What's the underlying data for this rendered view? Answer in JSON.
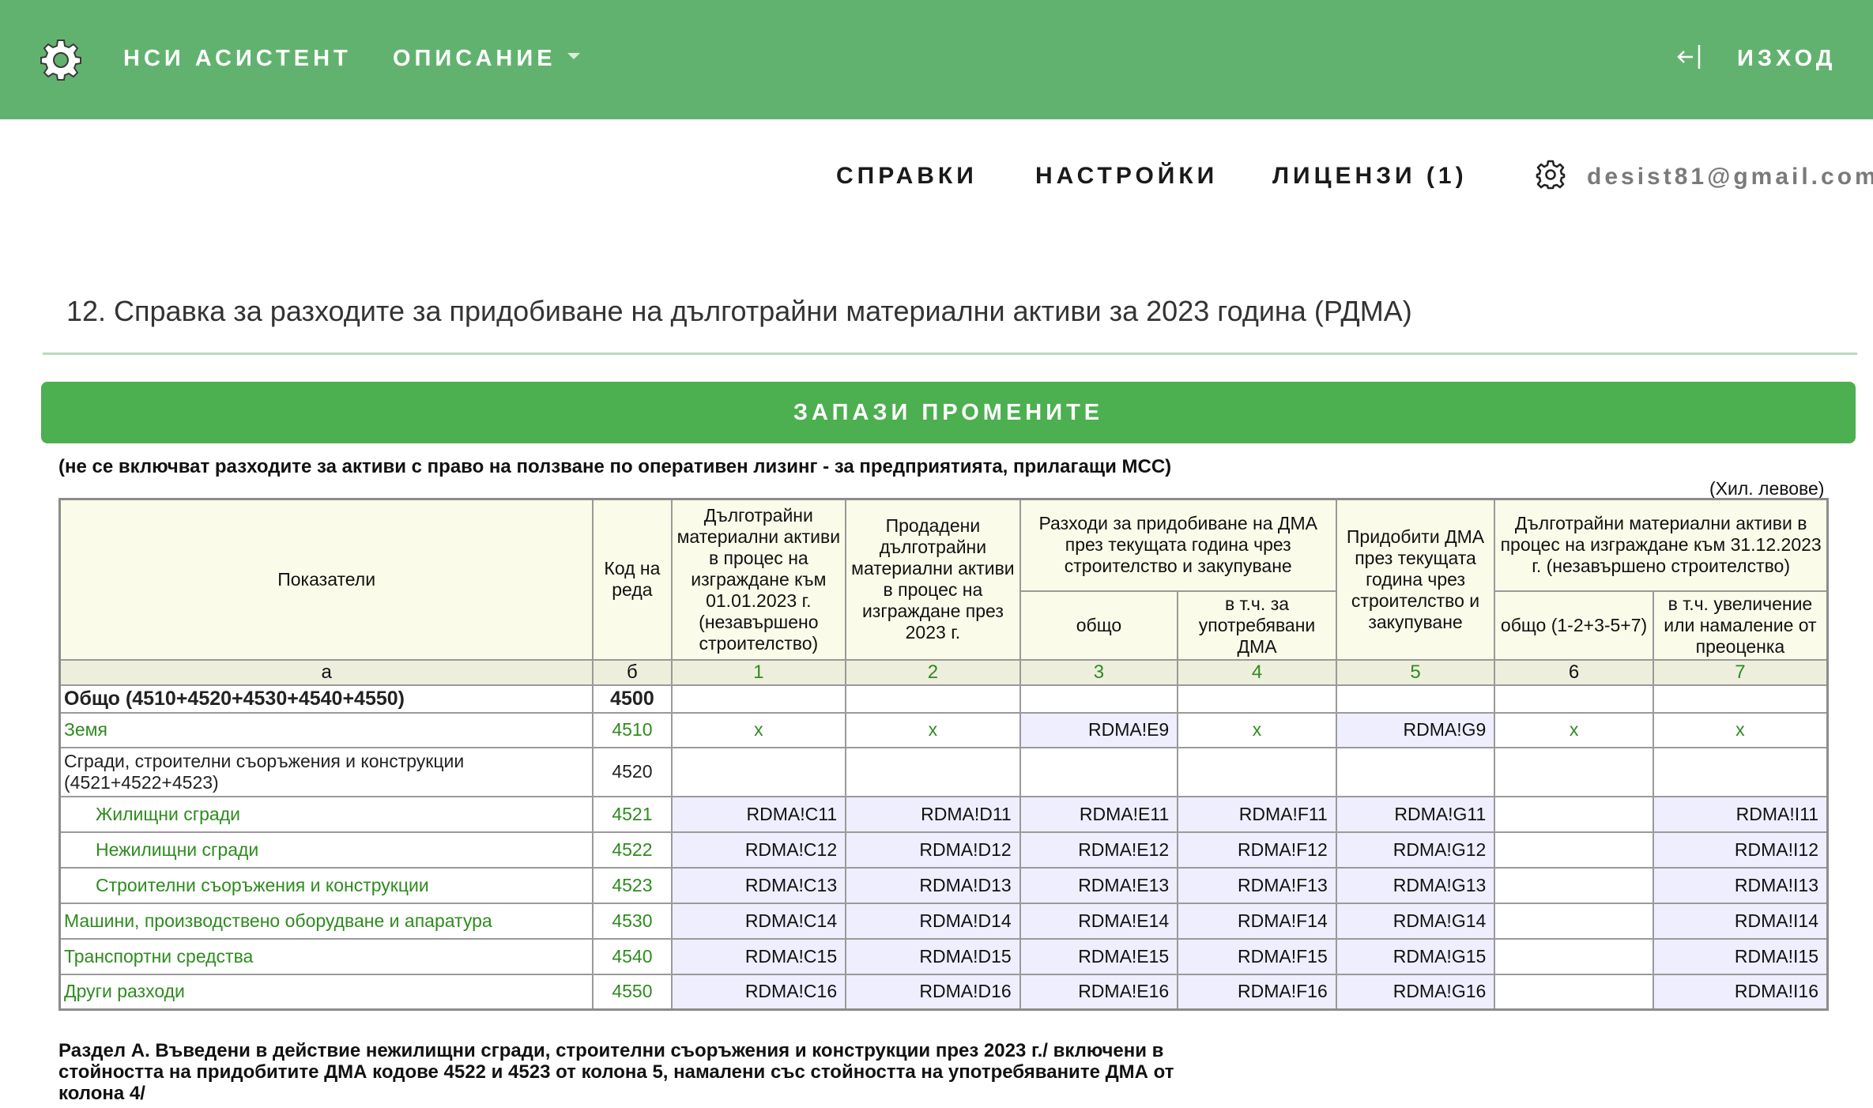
{
  "topbar": {
    "brand": "НСИ АСИСТЕНТ",
    "description_menu": "ОПИСАНИЕ",
    "logout_label": "ИЗХОД"
  },
  "menu": {
    "reports": "СПРАВКИ",
    "settings": "НАСТРОЙКИ",
    "licenses": "ЛИЦЕНЗИ (1)",
    "user_email": "desist81@gmail.com"
  },
  "page": {
    "title": "12. Справка за разходите за придобиване на дълготрайни материални активи за 2023 година (РДМА)",
    "save_button": "ЗАПАЗИ ПРОМЕНИТЕ",
    "note": "(не се включват разходите за активи с право на ползване по оперативен лизинг - за предприятията, прилагащи МСС)",
    "units": "(Хил. левове)",
    "section_a": "Раздел А. Въведени в действие нежилищни сгради, строителни съоръжения и конструкции през 2023 г./ включени в стойността на придобитите ДМА кодове 4522 и 4523 от колона 5, намалени със стойността на употребяваните ДМА от колона 4/"
  },
  "table": {
    "headers": {
      "indicators": "Показатели",
      "code": "Код на реда",
      "c1": "Дълготрайни материални активи в процес на изграждане към 01.01.2023 г. (незавършено строителство)",
      "c2": "Продадени дълготрайни материални активи в процес на изграждане през 2023 г.",
      "c34": "Разходи за придобиване на ДМА през текущата година чрез строителство и закупуване",
      "c3": "общо",
      "c4": "в т.ч. за употребявани ДМА",
      "c5": "Придобити ДМА през текущата година чрез строителство и закупуване",
      "c67": "Дълготрайни материални активи в процес на изграждане към 31.12.2023 г. (незавършено строителство)",
      "c6": "общо (1-2+3-5+7)",
      "c7": "в т.ч. увеличение или намаление от преоценка"
    },
    "col_numbers": [
      "а",
      "б",
      "1",
      "2",
      "3",
      "4",
      "5",
      "6",
      "7"
    ],
    "rows": [
      {
        "label": "Общо (4510+4520+4530+4540+4550)",
        "code": "4500",
        "c1": "",
        "c2": "",
        "c3": "",
        "c4": "",
        "c5": "",
        "c6": "",
        "c7": ""
      },
      {
        "label": "Земя",
        "code": "4510",
        "c1": "x",
        "c2": "x",
        "c3": "RDMA!E9",
        "c4": "x",
        "c5": "RDMA!G9",
        "c6": "x",
        "c7": "x"
      },
      {
        "label": "Сгради, строителни съоръжения и конструкции (4521+4522+4523)",
        "code": "4520",
        "c1": "",
        "c2": "",
        "c3": "",
        "c4": "",
        "c5": "",
        "c6": "",
        "c7": ""
      },
      {
        "label": "Жилищни сгради",
        "code": "4521",
        "c1": "RDMA!C11",
        "c2": "RDMA!D11",
        "c3": "RDMA!E11",
        "c4": "RDMA!F11",
        "c5": "RDMA!G11",
        "c6": "",
        "c7": "RDMA!I11"
      },
      {
        "label": "Нежилищни сгради",
        "code": "4522",
        "c1": "RDMA!C12",
        "c2": "RDMA!D12",
        "c3": "RDMA!E12",
        "c4": "RDMA!F12",
        "c5": "RDMA!G12",
        "c6": "",
        "c7": "RDMA!I12"
      },
      {
        "label": "Строителни съоръжения и конструкции",
        "code": "4523",
        "c1": "RDMA!C13",
        "c2": "RDMA!D13",
        "c3": "RDMA!E13",
        "c4": "RDMA!F13",
        "c5": "RDMA!G13",
        "c6": "",
        "c7": "RDMA!I13"
      },
      {
        "label": "Машини, производствено оборудване и апаратура",
        "code": "4530",
        "c1": "RDMA!C14",
        "c2": "RDMA!D14",
        "c3": "RDMA!E14",
        "c4": "RDMA!F14",
        "c5": "RDMA!G14",
        "c6": "",
        "c7": "RDMA!I14"
      },
      {
        "label": "Транспортни средства",
        "code": "4540",
        "c1": "RDMA!C15",
        "c2": "RDMA!D15",
        "c3": "RDMA!E15",
        "c4": "RDMA!F15",
        "c5": "RDMA!G15",
        "c6": "",
        "c7": "RDMA!I15"
      },
      {
        "label": "Други разходи",
        "code": "4550",
        "c1": "RDMA!C16",
        "c2": "RDMA!D16",
        "c3": "RDMA!E16",
        "c4": "RDMA!F16",
        "c5": "RDMA!G16",
        "c6": "",
        "c7": "RDMA!I16"
      }
    ]
  }
}
